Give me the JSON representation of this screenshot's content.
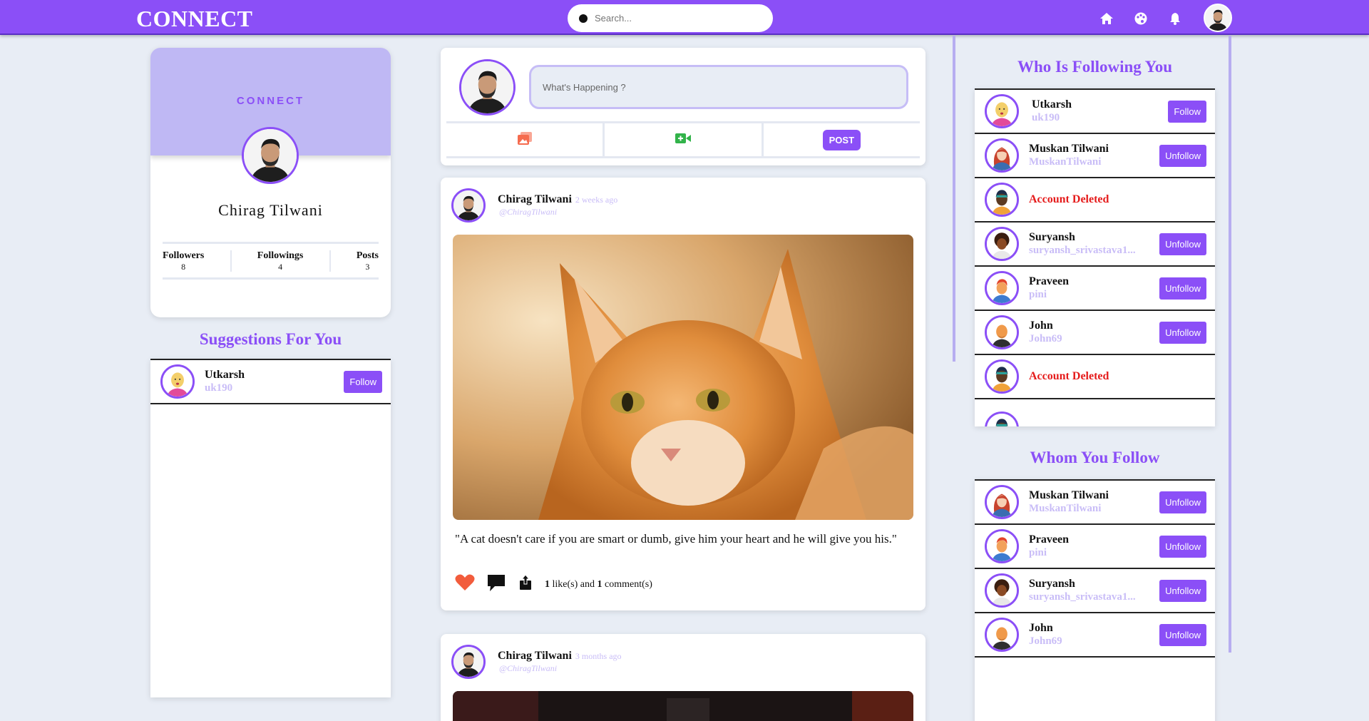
{
  "app": {
    "brand": "CONNECT"
  },
  "search": {
    "placeholder": "Search..."
  },
  "nav": {
    "icons": [
      "home-icon",
      "palette-icon",
      "bell-icon"
    ]
  },
  "colors": {
    "accent": "#8b4ff7",
    "cover": "#bfb8f4",
    "handle": "#c9bdf7",
    "danger": "#e51b1b",
    "like": "#f25c3c"
  },
  "profile": {
    "cover_text": "CONNECT",
    "name": "Chirag Tilwani",
    "stats": [
      {
        "label": "Followers",
        "value": "8"
      },
      {
        "label": "Followings",
        "value": "4"
      },
      {
        "label": "Posts",
        "value": "3"
      }
    ]
  },
  "suggestions": {
    "title": "Suggestions For You",
    "users": [
      {
        "name": "Utkarsh",
        "handle": "uk190",
        "button": "Follow"
      }
    ]
  },
  "composer": {
    "placeholder": "What's Happening ?",
    "post_label": "POST"
  },
  "posts": [
    {
      "author": "Chirag Tilwani",
      "time": "2 weeks ago",
      "handle": "@ChiragTilwani",
      "caption": "\"A cat doesn't care if you are smart or dumb, give him your heart and he will give you his.\"",
      "likes": "1",
      "comments": "1",
      "likes_suffix": "like(s) and",
      "comments_suffix": "comment(s)"
    },
    {
      "author": "Chirag Tilwani",
      "time": "3 months ago",
      "handle": "@ChiragTilwani"
    }
  ],
  "followers": {
    "title": "Who Is Following You",
    "users": [
      {
        "name": "Utkarsh",
        "handle": "uk190",
        "button": "Follow"
      },
      {
        "name": "Muskan Tilwani",
        "handle": "MuskanTilwani",
        "button": "Unfollow"
      },
      {
        "name": "Account Deleted",
        "deleted": true
      },
      {
        "name": "Suryansh",
        "handle": "suryansh_srivastava1...",
        "button": "Unfollow"
      },
      {
        "name": "Praveen",
        "handle": "pini",
        "button": "Unfollow"
      },
      {
        "name": "John",
        "handle": "John69",
        "button": "Unfollow"
      },
      {
        "name": "Account Deleted",
        "deleted": true
      }
    ]
  },
  "following": {
    "title": "Whom You Follow",
    "users": [
      {
        "name": "Muskan Tilwani",
        "handle": "MuskanTilwani",
        "button": "Unfollow"
      },
      {
        "name": "Praveen",
        "handle": "pini",
        "button": "Unfollow"
      },
      {
        "name": "Suryansh",
        "handle": "suryansh_srivastava1...",
        "button": "Unfollow"
      },
      {
        "name": "John",
        "handle": "John69",
        "button": "Unfollow"
      }
    ]
  }
}
